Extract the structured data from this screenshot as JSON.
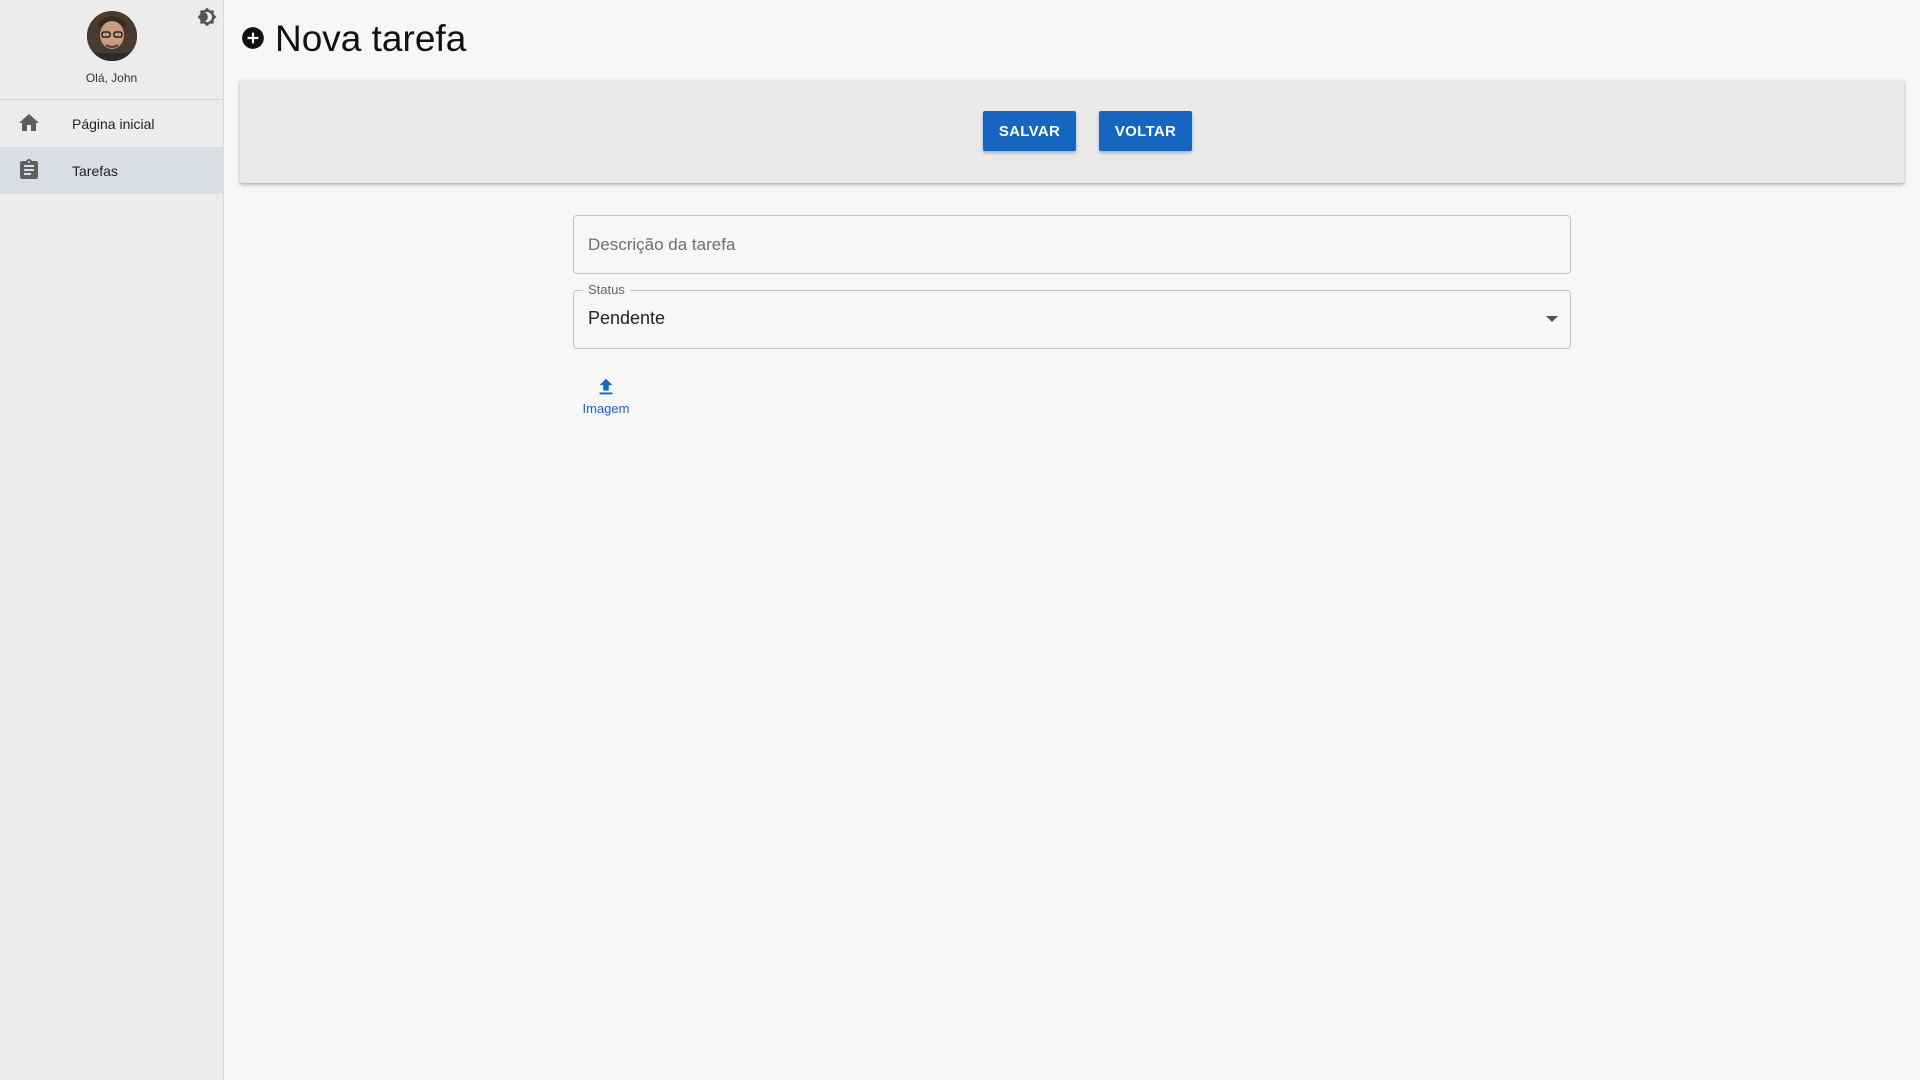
{
  "sidebar": {
    "greeting": "Olá, John",
    "items": [
      {
        "label": "Página inicial",
        "icon": "home-icon"
      },
      {
        "label": "Tarefas",
        "icon": "clipboard-icon",
        "active": true
      }
    ]
  },
  "page": {
    "title": "Nova tarefa",
    "icon": "add-circle-icon"
  },
  "toolbar": {
    "save_label": "SALVAR",
    "back_label": "VOLTAR"
  },
  "form": {
    "description": {
      "placeholder": "Descrição da tarefa",
      "value": ""
    },
    "status": {
      "label": "Status",
      "value": "Pendente"
    },
    "upload": {
      "label": "Imagem",
      "icon": "upload-icon"
    }
  },
  "colors": {
    "accent": "#1665c0",
    "sidebar_bg": "#ececec",
    "active_item_bg": "#d8dee6",
    "page_bg": "#f7f7f7"
  }
}
